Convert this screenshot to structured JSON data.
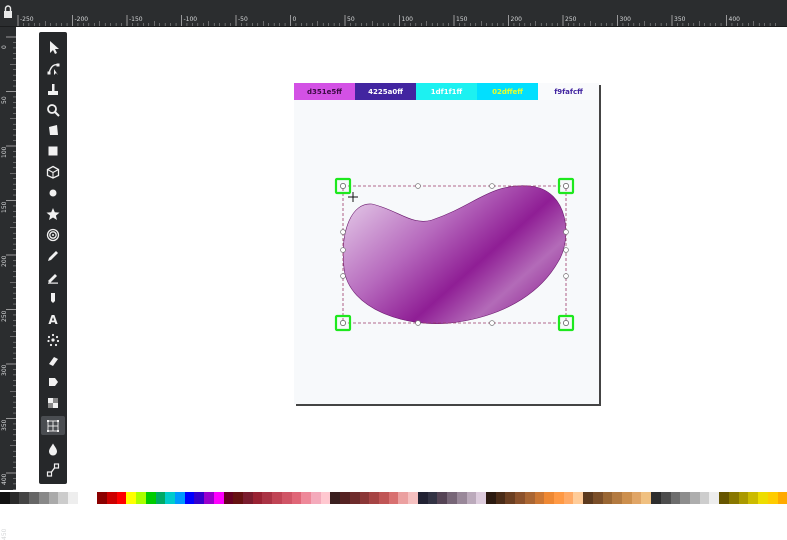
{
  "window": {
    "title": ""
  },
  "ruler": {
    "horizontal_labels": [
      "-250",
      "-200",
      "-150",
      "-100",
      "-50",
      "0",
      "50",
      "100",
      "150",
      "200",
      "250",
      "300",
      "350",
      "400"
    ],
    "vertical_labels": [
      "0",
      "50",
      "100",
      "150",
      "200",
      "250",
      "300",
      "350",
      "400",
      "450"
    ]
  },
  "toolbar": {
    "tools": [
      {
        "name": "selector-tool",
        "icon": "arrow-pointer-icon",
        "active": false
      },
      {
        "name": "node-tool",
        "icon": "node-editor-icon",
        "active": false
      },
      {
        "name": "tweak-tool",
        "icon": "brush-icon",
        "active": false
      },
      {
        "name": "zoom-tool",
        "icon": "magnifier-icon",
        "active": false
      },
      {
        "name": "measure-tool",
        "icon": "ruler-icon",
        "active": false
      },
      {
        "name": "rectangle-tool",
        "icon": "square-icon",
        "active": false
      },
      {
        "name": "3d-box-tool",
        "icon": "cube-icon",
        "active": false
      },
      {
        "name": "ellipse-tool",
        "icon": "circle-icon",
        "active": false
      },
      {
        "name": "star-tool",
        "icon": "star-icon",
        "active": false
      },
      {
        "name": "spiral-tool",
        "icon": "spiral-icon",
        "active": false
      },
      {
        "name": "pencil-tool",
        "icon": "pencil-icon",
        "active": false
      },
      {
        "name": "pen-tool",
        "icon": "pen-icon",
        "active": false
      },
      {
        "name": "calligraphy-tool",
        "icon": "calligraphy-icon",
        "active": false
      },
      {
        "name": "text-tool",
        "icon": "text-icon",
        "active": false
      },
      {
        "name": "spray-tool",
        "icon": "spray-icon",
        "active": false
      },
      {
        "name": "eraser-tool",
        "icon": "eraser-icon",
        "active": false
      },
      {
        "name": "paint-bucket-tool",
        "icon": "bucket-icon",
        "active": false
      },
      {
        "name": "gradient-tool",
        "icon": "gradient-icon",
        "active": false
      },
      {
        "name": "mesh-tool",
        "icon": "mesh-icon",
        "active": true
      },
      {
        "name": "dropper-tool",
        "icon": "dropper-icon",
        "active": false
      },
      {
        "name": "connector-tool",
        "icon": "connector-icon",
        "active": false
      }
    ]
  },
  "swatches": [
    {
      "label": "d351e5ff",
      "bg": "#d351e5",
      "fg": "#3b0b44"
    },
    {
      "label": "4225a0ff",
      "bg": "#4225a0",
      "fg": "#ffffff"
    },
    {
      "label": "1df1f1ff",
      "bg": "#1df1f1",
      "fg": "#ffffff"
    },
    {
      "label": "02dffeff",
      "bg": "#02dffe",
      "fg": "#e8ff2a"
    },
    {
      "label": "f9fafcff",
      "bg": "#f9fafc",
      "fg": "#4225a0"
    }
  ],
  "palette": [
    "#111111",
    "#2a2a2a",
    "#444444",
    "#666666",
    "#888888",
    "#aaaaaa",
    "#cccccc",
    "#eeeeee",
    "#ffffff",
    "#ffffff",
    "#8b0000",
    "#cc0000",
    "#ff0000",
    "#ffff00",
    "#aaff00",
    "#00cc00",
    "#00aa66",
    "#00cccc",
    "#0099ff",
    "#0000ff",
    "#3300cc",
    "#9900cc",
    "#ff00ff",
    "#660022",
    "#661111",
    "#7a1c2e",
    "#992233",
    "#aa3344",
    "#c04455",
    "#d05566",
    "#e06677",
    "#ee8899",
    "#f4aabb",
    "#ffc8d0",
    "#3a1f1f",
    "#552222",
    "#6e2b2b",
    "#8a3636",
    "#a64444",
    "#c05555",
    "#d87070",
    "#eba0a0",
    "#f5c0c0",
    "#222233",
    "#333344",
    "#554455",
    "#776677",
    "#998899",
    "#bbaabb",
    "#ddccdd",
    "#2b1a10",
    "#4a2c18",
    "#6b3f22",
    "#8c522c",
    "#aa6633",
    "#cc7733",
    "#ee8833",
    "#ff9944",
    "#ffaa66",
    "#ffcc99",
    "#5c3a1e",
    "#7a4e28",
    "#996633",
    "#b37a40",
    "#cc8f4d",
    "#e0a566",
    "#f0c080",
    "#2d2d2d",
    "#4d4d4d",
    "#6d6d6d",
    "#8d8d8d",
    "#adadad",
    "#cdcdcd",
    "#ededed",
    "#665500",
    "#887700",
    "#aa9900",
    "#ccbb00",
    "#eedd00",
    "#ffcc00",
    "#ffaa00"
  ],
  "status": {
    "text": ""
  }
}
